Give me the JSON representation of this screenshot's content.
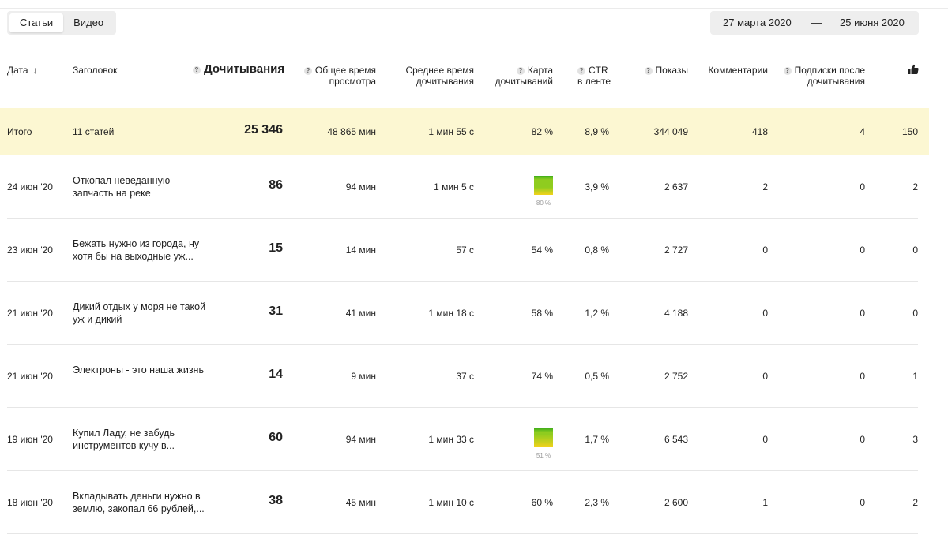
{
  "tabs": [
    {
      "label": "Статьи",
      "active": true
    },
    {
      "label": "Видео",
      "active": false
    }
  ],
  "date_range": {
    "from": "27 марта 2020",
    "separator": "—",
    "to": "25 июня 2020"
  },
  "columns": {
    "date": "Дата",
    "title": "Заголовок",
    "read_through": "Дочитывания",
    "total_time_line1": "Общее время",
    "total_time_line2": "просмотра",
    "avg_time_line1": "Среднее время",
    "avg_time_line2": "дочитывания",
    "map_line1": "Карта",
    "map_line2": "дочитываний",
    "ctr_line1": "CTR",
    "ctr_line2": "в ленте",
    "shows": "Показы",
    "comments": "Комментарии",
    "subs_line1": "Подписки после",
    "subs_line2": "дочитывания",
    "likes_icon": "thumbs-up-icon"
  },
  "total": {
    "label": "Итого",
    "title": "11 статей",
    "read_through": "25 346",
    "total_time": "48 865 мин",
    "avg_time": "1 мин 55 с",
    "map": "82 %",
    "ctr": "8,9 %",
    "shows": "344 049",
    "comments": "418",
    "subs": "4",
    "likes": "150"
  },
  "rows": [
    {
      "date": "24 июн '20",
      "title": "Откопал неведанную запчасть на реке",
      "read_through": "86",
      "total_time": "94 мин",
      "avg_time": "1 мин 5 с",
      "map": "80 %",
      "map_is_chart": true,
      "map_value": 0.8,
      "ctr": "3,9 %",
      "shows": "2 637",
      "comments": "2",
      "subs": "0",
      "likes": "2"
    },
    {
      "date": "23 июн '20",
      "title": "Бежать нужно из города, ну хотя бы на выходные уж...",
      "read_through": "15",
      "total_time": "14 мин",
      "avg_time": "57 с",
      "map": "54 %",
      "map_is_chart": false,
      "ctr": "0,8 %",
      "shows": "2 727",
      "comments": "0",
      "subs": "0",
      "likes": "0"
    },
    {
      "date": "21 июн '20",
      "title": "Дикий отдых у моря не такой уж и дикий",
      "read_through": "31",
      "total_time": "41 мин",
      "avg_time": "1 мин 18 с",
      "map": "58 %",
      "map_is_chart": false,
      "ctr": "1,2 %",
      "shows": "4 188",
      "comments": "0",
      "subs": "0",
      "likes": "0"
    },
    {
      "date": "21 июн '20",
      "title": "Электроны - это наша жизнь",
      "read_through": "14",
      "total_time": "9 мин",
      "avg_time": "37 с",
      "map": "74 %",
      "map_is_chart": false,
      "ctr": "0,5 %",
      "shows": "2 752",
      "comments": "0",
      "subs": "0",
      "likes": "1"
    },
    {
      "date": "19 июн '20",
      "title": "Купил Ладу, не забудь инструментов кучу в...",
      "read_through": "60",
      "total_time": "94 мин",
      "avg_time": "1 мин 33 с",
      "map": "51 %",
      "map_is_chart": true,
      "map_value": 0.51,
      "ctr": "1,7 %",
      "shows": "6 543",
      "comments": "0",
      "subs": "0",
      "likes": "3"
    },
    {
      "date": "18 июн '20",
      "title": "Вкладывать деньги нужно в землю, закопал 66 рублей,...",
      "read_through": "38",
      "total_time": "45 мин",
      "avg_time": "1 мин 10 с",
      "map": "60 %",
      "map_is_chart": false,
      "ctr": "2,3 %",
      "shows": "2 600",
      "comments": "1",
      "subs": "0",
      "likes": "2"
    }
  ],
  "colors": {
    "total_row_bg": "#fcf7d2",
    "heat_green": "#8fcc1f",
    "heat_yellow": "#f2d21b",
    "tabs_bg": "#eeeeee"
  }
}
